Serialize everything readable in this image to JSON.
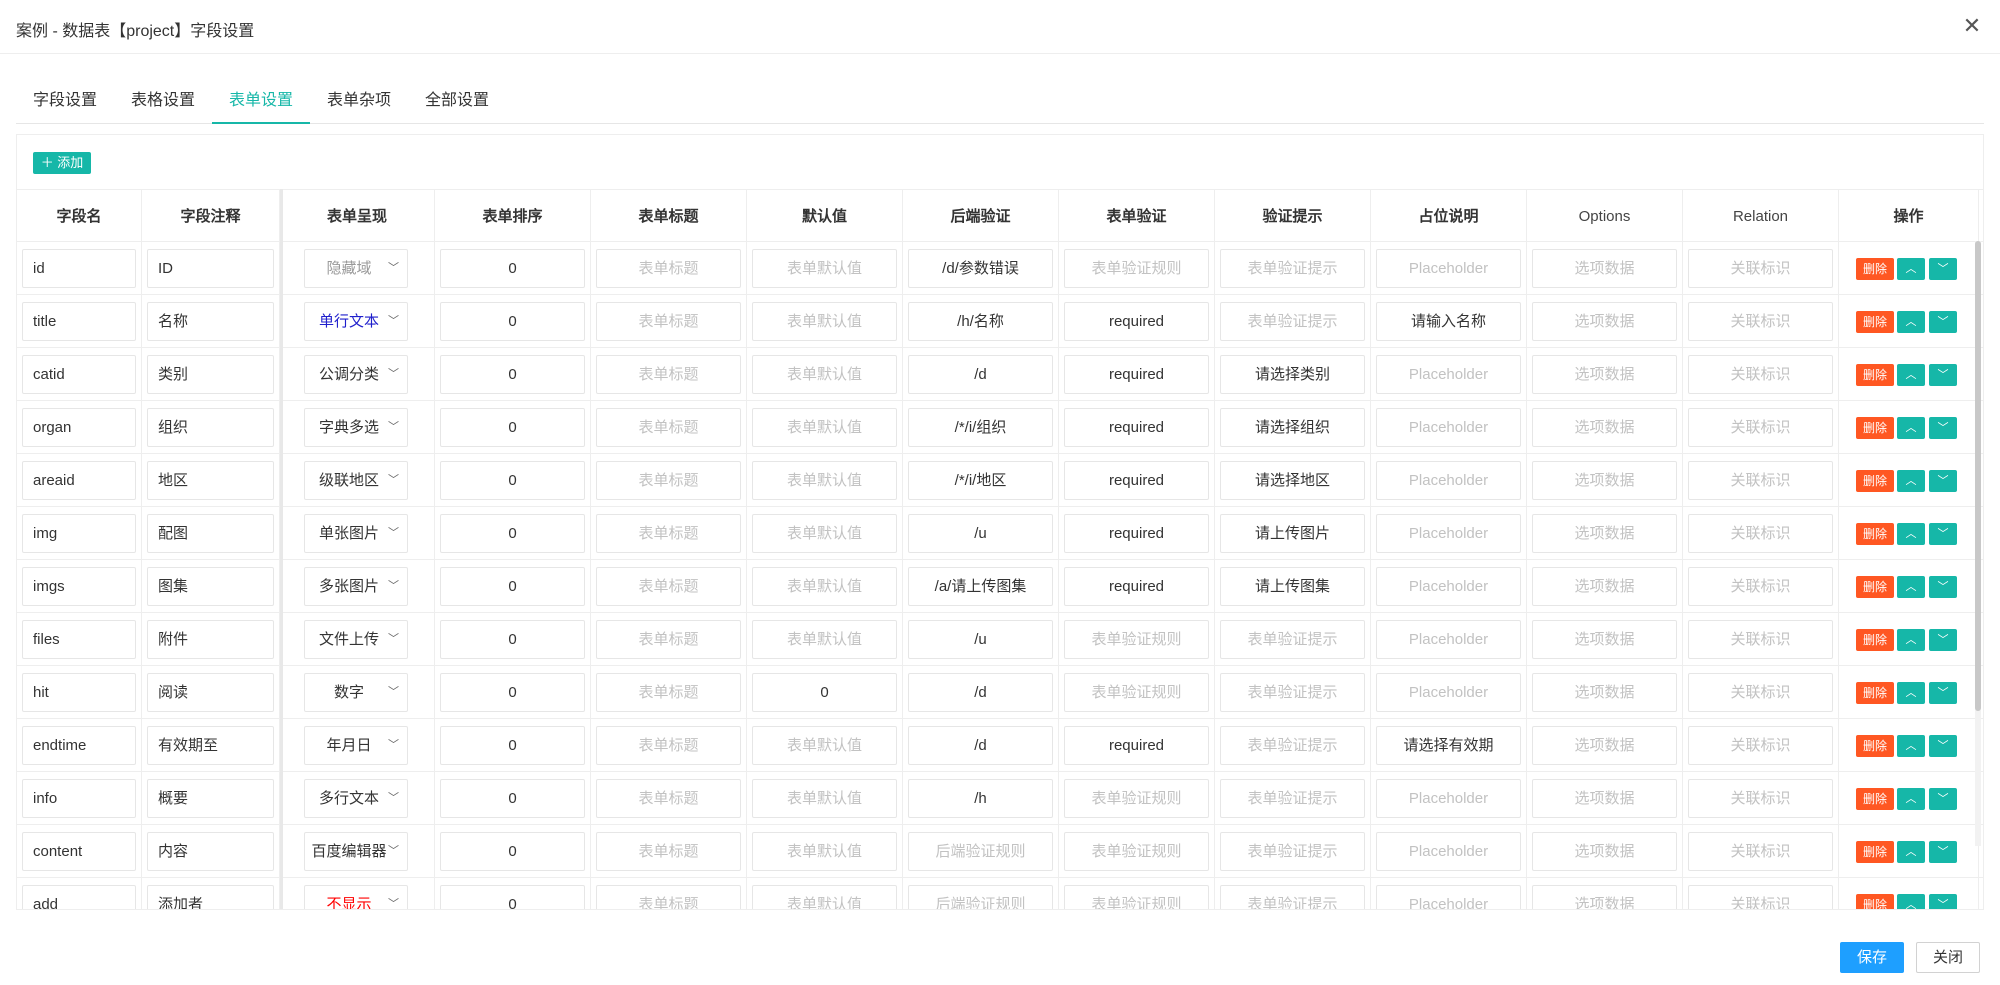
{
  "window": {
    "title": "案例 - 数据表【project】字段设置",
    "close_glyph": "✕"
  },
  "tabs": [
    {
      "label": "字段设置",
      "active": false
    },
    {
      "label": "表格设置",
      "active": false
    },
    {
      "label": "表单设置",
      "active": true
    },
    {
      "label": "表单杂项",
      "active": false
    },
    {
      "label": "全部设置",
      "active": false
    }
  ],
  "toolbar": {
    "add_label": "＋ 添加"
  },
  "columns": [
    "字段名",
    "字段注释",
    "表单呈现",
    "表单排序",
    "表单标题",
    "默认值",
    "后端验证",
    "表单验证",
    "验证提示",
    "占位说明",
    "Options",
    "Relation",
    "操作"
  ],
  "placeholders": {
    "title": "表单标题",
    "default": "表单默认值",
    "backend": "后端验证规则",
    "validate": "表单验证规则",
    "hint": "表单验证提示",
    "placeholder": "Placeholder",
    "options": "选项数据",
    "relation": "关联标识"
  },
  "actions": {
    "delete": "删除",
    "up": "︿",
    "down": "﹀"
  },
  "colors": {
    "accent": "#16b7a8",
    "danger": "#ff5722",
    "primary": "#1e9fff",
    "blue_text": "#1f1fcc",
    "red_text": "#ff0000"
  },
  "rows": [
    {
      "name": "id",
      "comment": "ID",
      "render": "隐藏域",
      "render_color": "gray",
      "order": "0",
      "title": "",
      "default": "",
      "backend": "/d/参数错误",
      "validate": "",
      "hint": "",
      "placeholder": "",
      "options": "",
      "relation": ""
    },
    {
      "name": "title",
      "comment": "名称",
      "render": "单行文本",
      "render_color": "blue",
      "order": "0",
      "title": "",
      "default": "",
      "backend": "/h/名称",
      "validate": "required",
      "hint": "",
      "placeholder": "请输入名称",
      "options": "",
      "relation": ""
    },
    {
      "name": "catid",
      "comment": "类别",
      "render": "公调分类",
      "render_color": "normal",
      "order": "0",
      "title": "",
      "default": "",
      "backend": "/d",
      "validate": "required",
      "hint": "请选择类别",
      "placeholder": "",
      "options": "",
      "relation": ""
    },
    {
      "name": "organ",
      "comment": "组织",
      "render": "字典多选",
      "render_color": "normal",
      "order": "0",
      "title": "",
      "default": "",
      "backend": "/*/i/组织",
      "validate": "required",
      "hint": "请选择组织",
      "placeholder": "",
      "options": "",
      "relation": ""
    },
    {
      "name": "areaid",
      "comment": "地区",
      "render": "级联地区",
      "render_color": "normal",
      "order": "0",
      "title": "",
      "default": "",
      "backend": "/*/i/地区",
      "validate": "required",
      "hint": "请选择地区",
      "placeholder": "",
      "options": "",
      "relation": ""
    },
    {
      "name": "img",
      "comment": "配图",
      "render": "单张图片",
      "render_color": "normal",
      "order": "0",
      "title": "",
      "default": "",
      "backend": "/u",
      "validate": "required",
      "hint": "请上传图片",
      "placeholder": "",
      "options": "",
      "relation": ""
    },
    {
      "name": "imgs",
      "comment": "图集",
      "render": "多张图片",
      "render_color": "normal",
      "order": "0",
      "title": "",
      "default": "",
      "backend": "/a/请上传图集",
      "validate": "required",
      "hint": "请上传图集",
      "placeholder": "",
      "options": "",
      "relation": ""
    },
    {
      "name": "files",
      "comment": "附件",
      "render": "文件上传",
      "render_color": "normal",
      "order": "0",
      "title": "",
      "default": "",
      "backend": "/u",
      "validate": "",
      "hint": "",
      "placeholder": "",
      "options": "",
      "relation": ""
    },
    {
      "name": "hit",
      "comment": "阅读",
      "render": "数字",
      "render_color": "normal",
      "order": "0",
      "title": "",
      "default": "0",
      "backend": "/d",
      "validate": "",
      "hint": "",
      "placeholder": "",
      "options": "",
      "relation": ""
    },
    {
      "name": "endtime",
      "comment": "有效期至",
      "render": "年月日",
      "render_color": "normal",
      "order": "0",
      "title": "",
      "default": "",
      "backend": "/d",
      "validate": "required",
      "hint": "",
      "placeholder": "请选择有效期",
      "options": "",
      "relation": ""
    },
    {
      "name": "info",
      "comment": "概要",
      "render": "多行文本",
      "render_color": "normal",
      "order": "0",
      "title": "",
      "default": "",
      "backend": "/h",
      "validate": "",
      "hint": "",
      "placeholder": "",
      "options": "",
      "relation": ""
    },
    {
      "name": "content",
      "comment": "内容",
      "render": "百度编辑器",
      "render_color": "normal",
      "order": "0",
      "title": "",
      "default": "",
      "backend": "",
      "validate": "",
      "hint": "",
      "placeholder": "",
      "options": "",
      "relation": ""
    },
    {
      "name": "add",
      "comment": "添加者",
      "render": "不显示",
      "render_color": "red",
      "order": "0",
      "title": "",
      "default": "",
      "backend": "",
      "validate": "",
      "hint": "",
      "placeholder": "",
      "options": "",
      "relation": ""
    }
  ],
  "footer": {
    "save_label": "保存",
    "close_label": "关闭"
  }
}
